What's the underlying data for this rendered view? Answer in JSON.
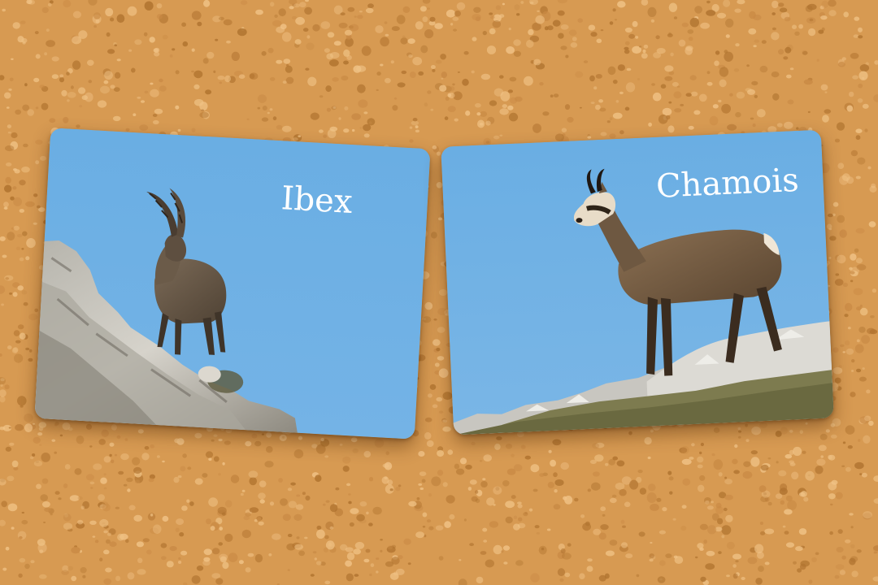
{
  "board": {
    "colors": {
      "cork": "#d79a52",
      "cork_light": "#f0c285",
      "cork_dark": "#b0732f",
      "sky": "#69abe0"
    }
  },
  "cards": [
    {
      "label": "Ibex",
      "image": "ibex-on-rocky-cliff"
    },
    {
      "label": "Chamois",
      "image": "chamois-on-rocky-ridge"
    }
  ]
}
